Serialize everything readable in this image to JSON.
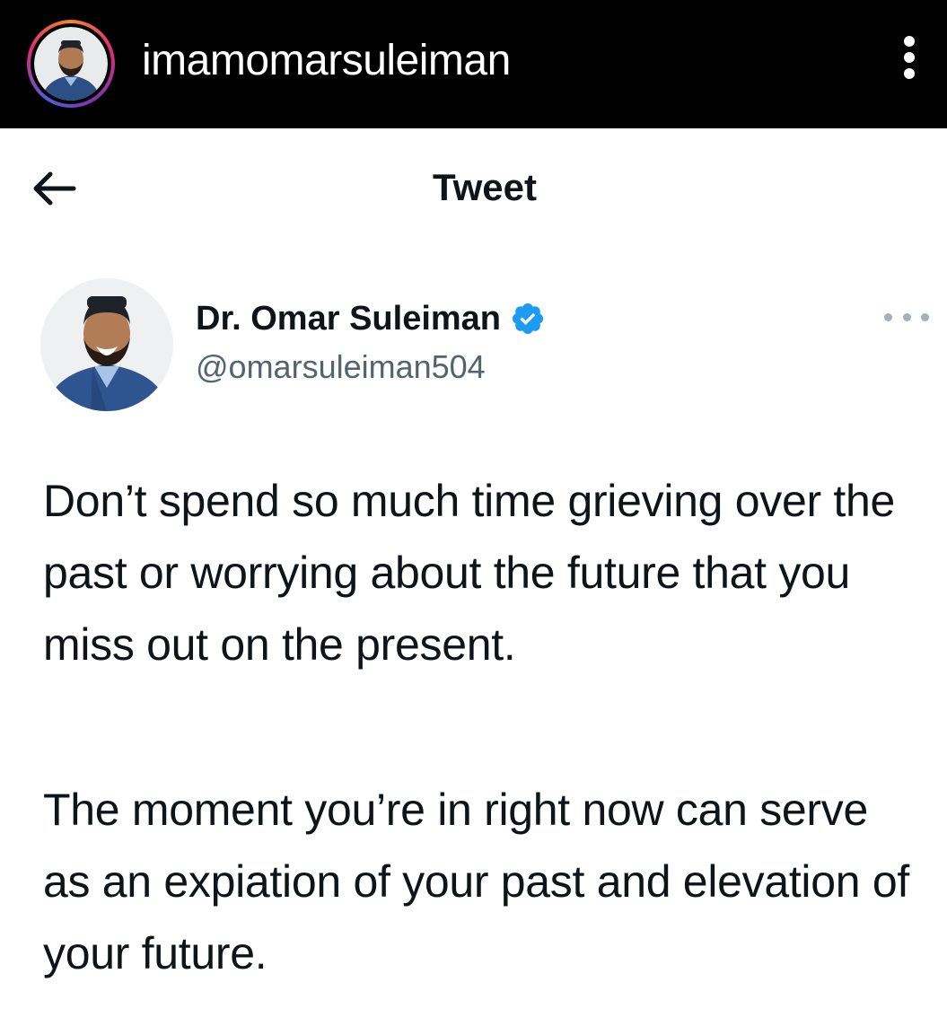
{
  "instagram": {
    "username": "imamomarsuleiman",
    "avatar_icon": "profile-photo-icon",
    "more_icon": "vertical-ellipsis-icon"
  },
  "tweet_header": {
    "back_icon": "arrow-left-icon",
    "title": "Tweet"
  },
  "tweet": {
    "author_name": "Dr. Omar Suleiman",
    "author_handle": "@omarsuleiman504",
    "verified_icon": "verified-badge-icon",
    "verified_color": "#1d9bf0",
    "more_icon": "horizontal-ellipsis-icon",
    "paragraphs": [
      "Don’t spend so much time grieving over the past or worrying about the future that you miss out on the present.",
      "The moment you’re in right now can serve as an expiation of your past and elevation of your future."
    ]
  }
}
